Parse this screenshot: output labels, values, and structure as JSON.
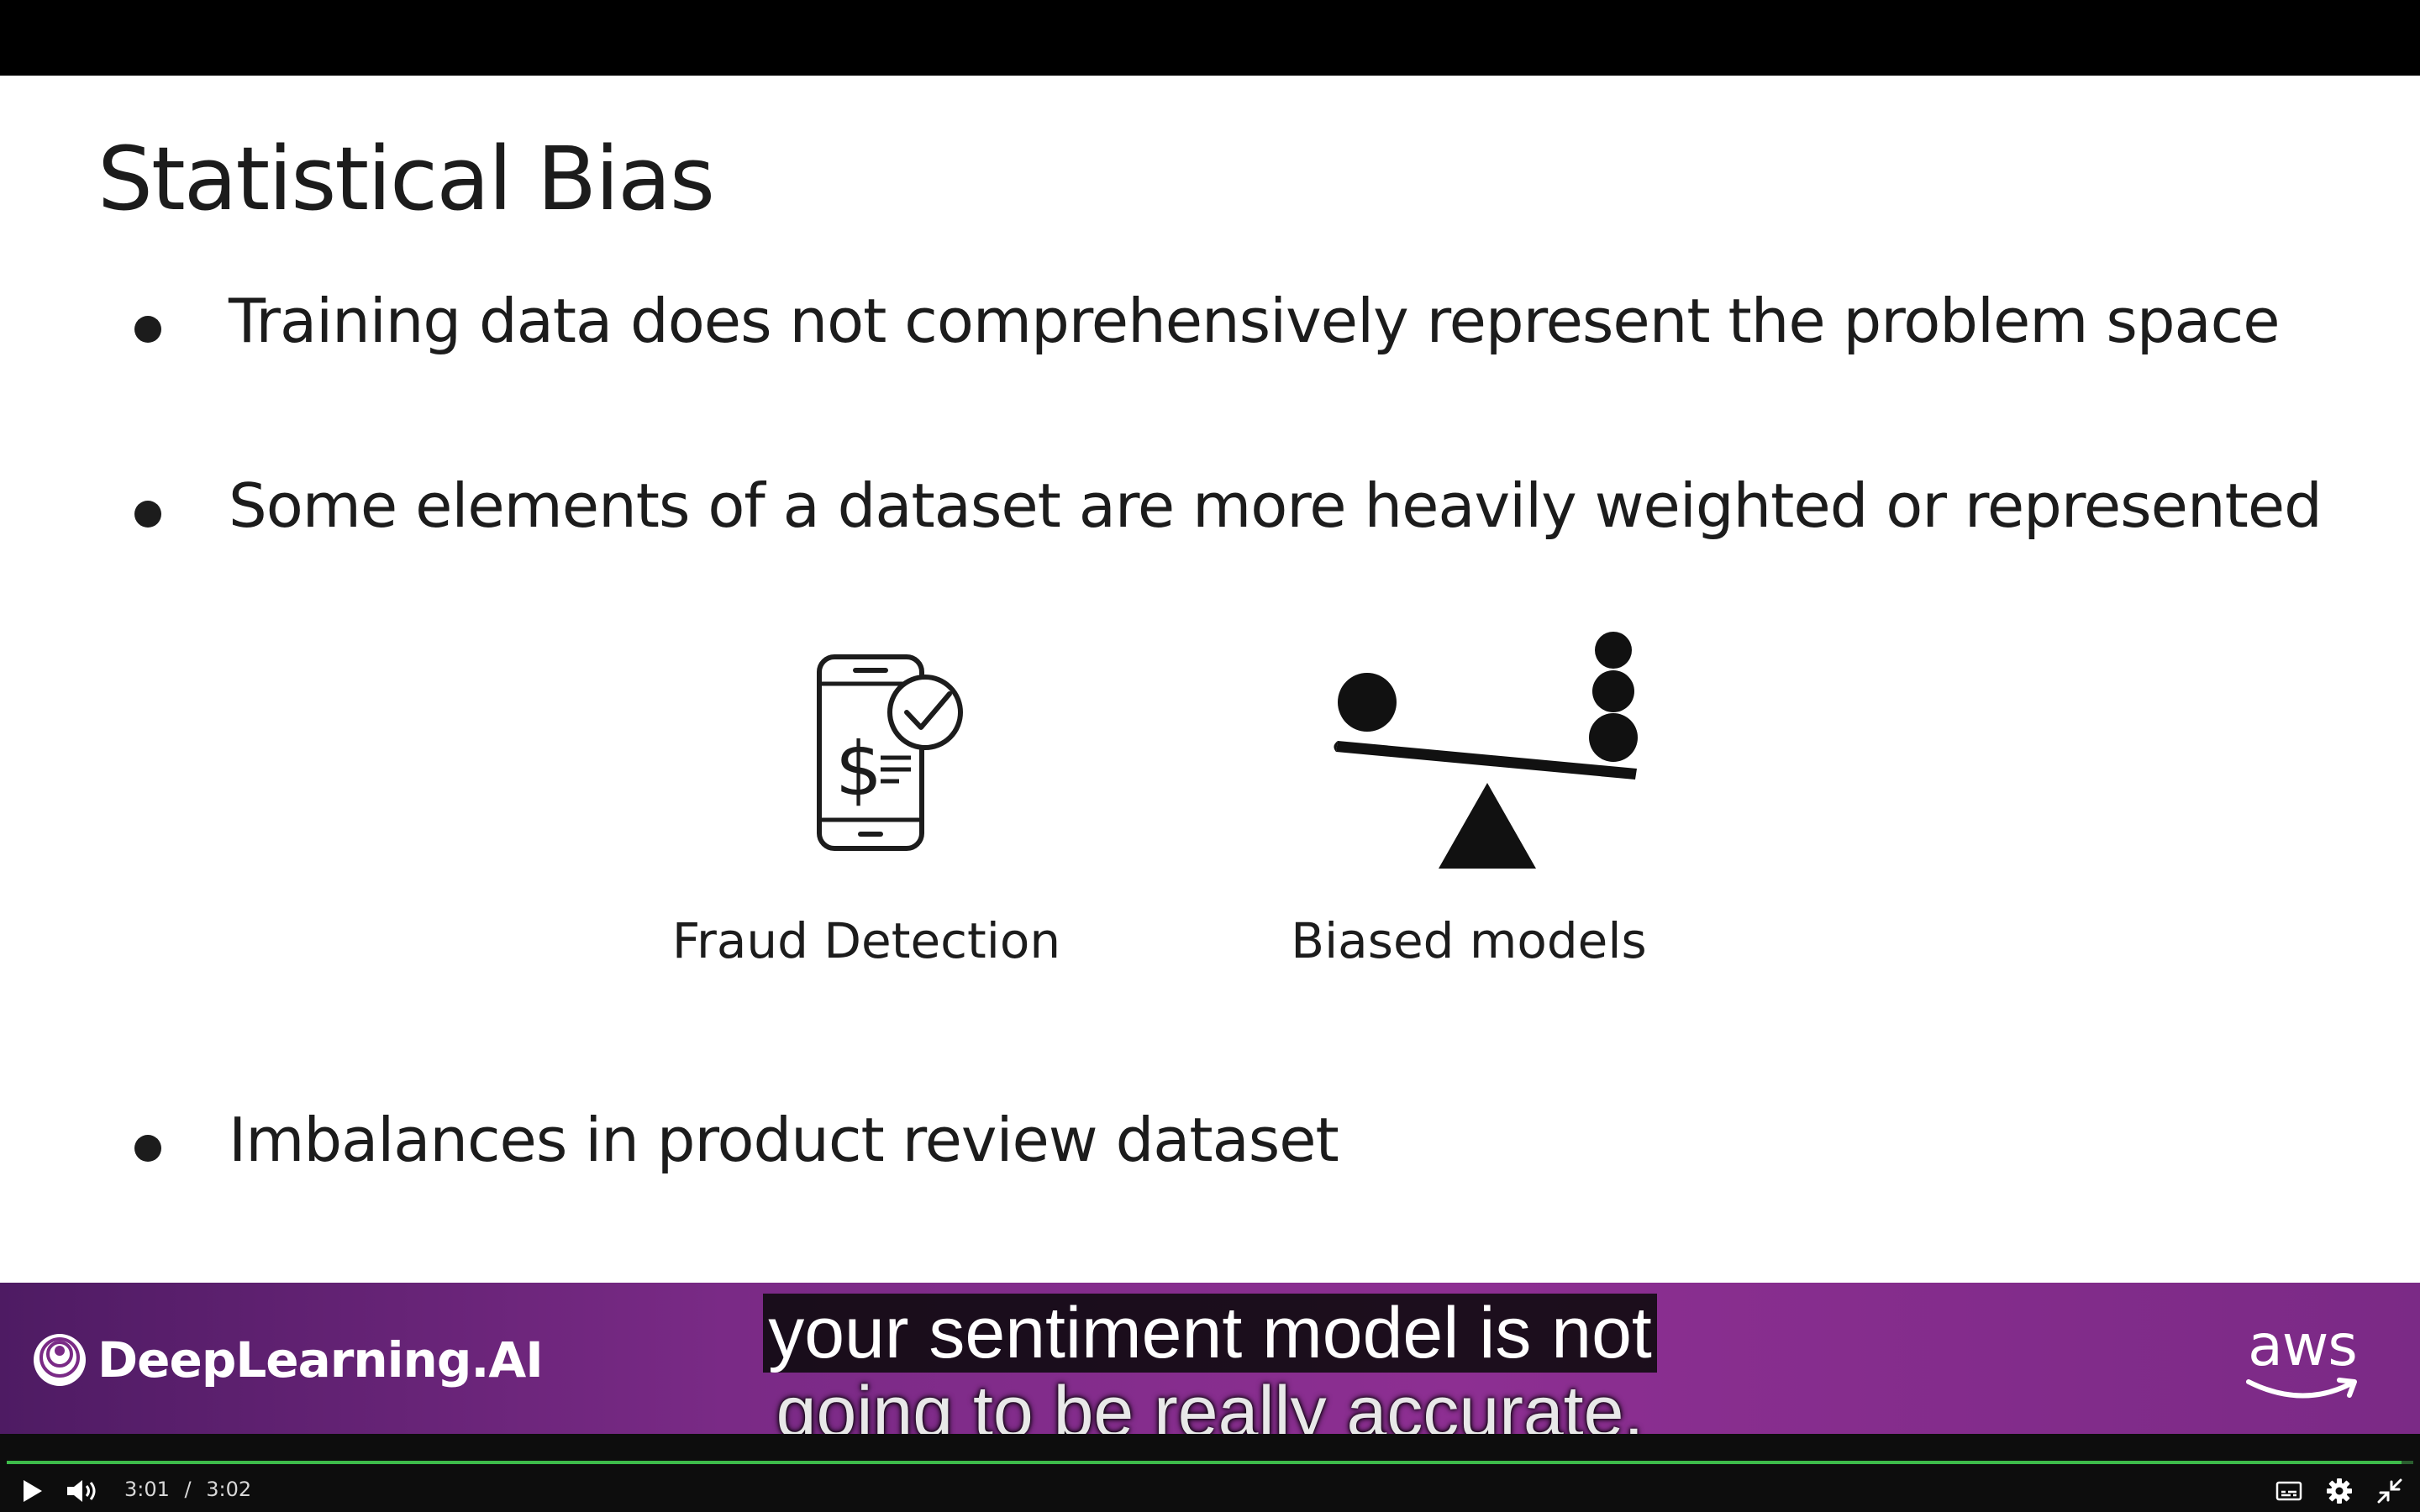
{
  "slide": {
    "title": "Statistical Bias",
    "bullets": [
      "Training data does not comprehensively represent the problem space",
      "Some elements of a dataset are more heavily weighted or represented",
      "Imbalances in product review dataset"
    ],
    "icons": [
      {
        "label": "Fraud Detection",
        "icon": "phone-payment-check-icon"
      },
      {
        "label": "Biased models",
        "icon": "seesaw-imbalance-icon"
      }
    ]
  },
  "branding": {
    "left_logo_text": "DeepLearning.AI",
    "right_logo_text": "aws",
    "accent_color": "#8d2f92"
  },
  "captions": {
    "line1": "your sentiment model is not",
    "line2": "going to be really accurate."
  },
  "player": {
    "current_time": "3:01",
    "separator": "/",
    "duration": "3:02",
    "progress_fraction": 0.995,
    "progress_color": "#3dbb4a",
    "icons": [
      "play-icon",
      "volume-icon",
      "captions-icon",
      "settings-icon",
      "exit-fullscreen-icon"
    ]
  }
}
